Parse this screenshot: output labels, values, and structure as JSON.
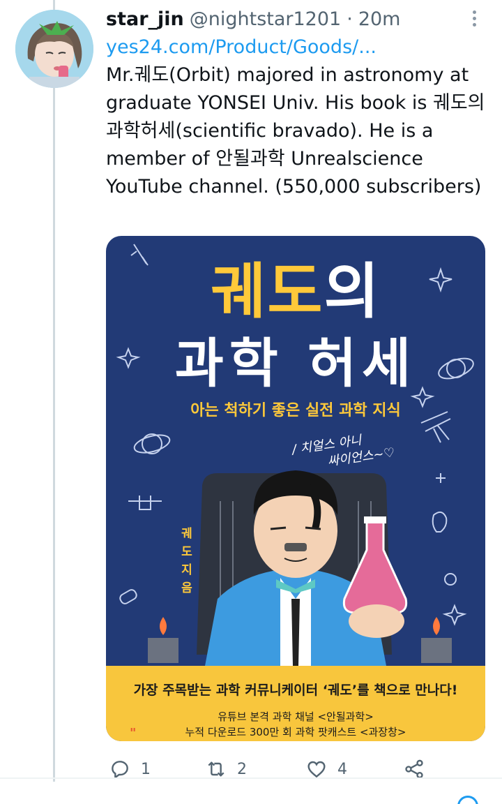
{
  "tweet": {
    "display_name": "star_jin",
    "handle": "@nightstar1201",
    "separator": "·",
    "time": "20m",
    "link": "yes24.com/Product/Goods/...",
    "text": "Mr.궤도(Orbit) majored in astronomy at graduate YONSEI Univ. His book is 궤도의 과학허세(scientific bravado). He is a member of 안될과학 Unrealscience YouTube channel. (550,000 subscribers)"
  },
  "book_cover": {
    "title_line1_a": "궤도",
    "title_line1_b": "의",
    "title_line2": "과학 허세",
    "subtitle": "아는 척하기 좋은 실전 과학 지식",
    "handwriting_1": "/ 치얼스 아니",
    "handwriting_2": "싸이언스~♡",
    "author_chars": [
      "궤",
      "도",
      "지",
      "음"
    ],
    "banner_main": "가장 주목받는 과학 커뮤니케이터 ‘궤도’를 책으로 만나다!",
    "banner_line1": "유튜브 본격 과학 채널 <안될과학>",
    "banner_line2": "누적 다운로드 300만 회 과학 팟캐스트 <과장창>",
    "banner_mark": "\"",
    "colors": {
      "background": "#223a76",
      "title": "#ffc93a",
      "banner": "#f8c63d"
    }
  },
  "actions": {
    "reply_count": "1",
    "retweet_count": "2",
    "like_count": "4"
  },
  "icons": [
    "more-icon",
    "reply-icon",
    "retweet-icon",
    "like-icon",
    "share-icon"
  ],
  "colors": {
    "link": "#1d9bf0",
    "muted": "#536471",
    "thread_line": "#cfd9de"
  }
}
